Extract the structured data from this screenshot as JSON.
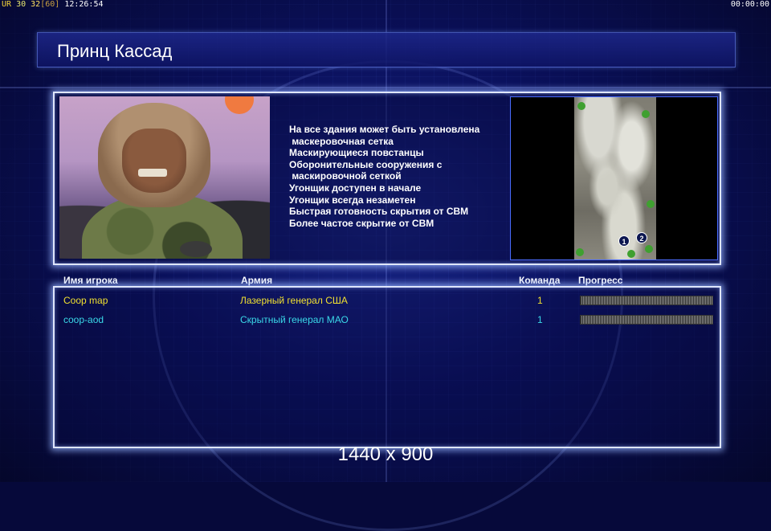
{
  "hud": {
    "ur_label": "UR",
    "value1": "30",
    "value2": "32",
    "value3": "[60]",
    "clock": "12:26:54",
    "timer": "00:00:00"
  },
  "title": "Принц Кассад",
  "description_lines": [
    "На все здания может быть установлена",
    " маскеровочная сетка",
    "Маскирующиеся повстанцы",
    "Оборонительные сооружения с",
    " маскировочной сеткой",
    "Угонщик доступен в начале",
    "Угонщик всегда незаметен",
    "Быстрая готовность скрытия от СВМ",
    "Более частое скрытие от СВМ"
  ],
  "map": {
    "spawns": [
      "1",
      "2"
    ]
  },
  "table": {
    "headers": {
      "player": "Имя игрока",
      "army": "Армия",
      "team": "Команда",
      "progress": "Прогресс"
    },
    "rows": [
      {
        "player": "Coop map",
        "army": "Лазерный генерал США",
        "team": "1",
        "color": "#f0e030",
        "progress": 1.0
      },
      {
        "player": "coop-aod",
        "army": "Скрытный генерал МАО",
        "team": "1",
        "color": "#3ad8e8",
        "progress": 1.0
      }
    ]
  },
  "resolution": "1440 x 900",
  "colors": {
    "accent": "#dfe6ff",
    "background": "#0a0f5a"
  }
}
